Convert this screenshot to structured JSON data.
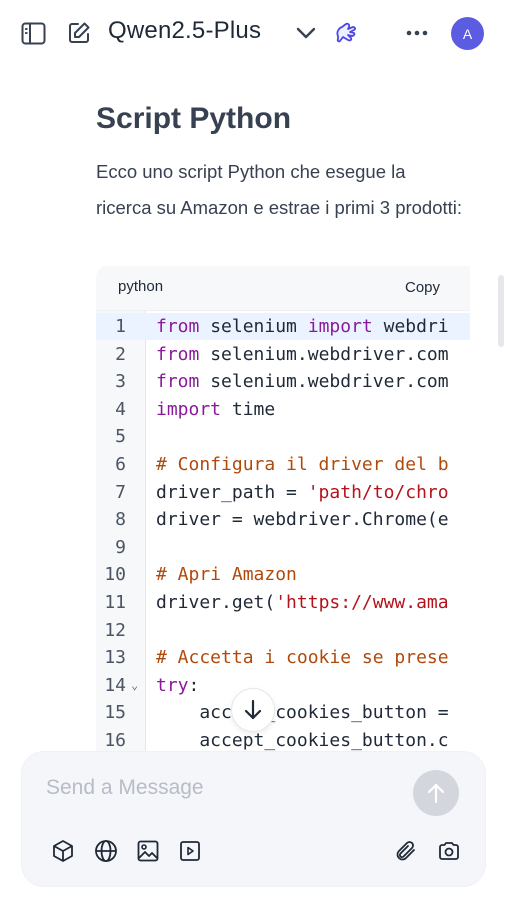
{
  "header": {
    "model_name": "Qwen2.5-Plus",
    "avatar_initial": "A"
  },
  "message": {
    "heading": "Script Python",
    "intro": "Ecco uno script Python che esegue la ricerca su Amazon e estrae i primi 3 prodotti:"
  },
  "code_block": {
    "language": "python",
    "copy_label": "Copy",
    "lines": [
      {
        "n": "1",
        "text": "from selenium import webdri"
      },
      {
        "n": "2",
        "text": "from selenium.webdriver.com"
      },
      {
        "n": "3",
        "text": "from selenium.webdriver.com"
      },
      {
        "n": "4",
        "text": "import time"
      },
      {
        "n": "5",
        "text": ""
      },
      {
        "n": "6",
        "text": "# Configura il driver del b"
      },
      {
        "n": "7",
        "text": "driver_path = 'path/to/chro"
      },
      {
        "n": "8",
        "text": "driver = webdriver.Chrome(e"
      },
      {
        "n": "9",
        "text": ""
      },
      {
        "n": "10",
        "text": "# Apri Amazon"
      },
      {
        "n": "11",
        "text": "driver.get('https://www.ama"
      },
      {
        "n": "12",
        "text": ""
      },
      {
        "n": "13",
        "text": "# Accetta i cookie se prese"
      },
      {
        "n": "14",
        "text": "try:"
      },
      {
        "n": "15",
        "text": "    accept_cookies_button ="
      },
      {
        "n": "16",
        "text": "    accept_cookies_button.c"
      }
    ]
  },
  "composer": {
    "placeholder": "Send a Message"
  },
  "colors": {
    "accent": "#5b5ce2",
    "keyword": "#8b1a9b",
    "comment": "#b04a0c",
    "string": "#b5121b"
  }
}
